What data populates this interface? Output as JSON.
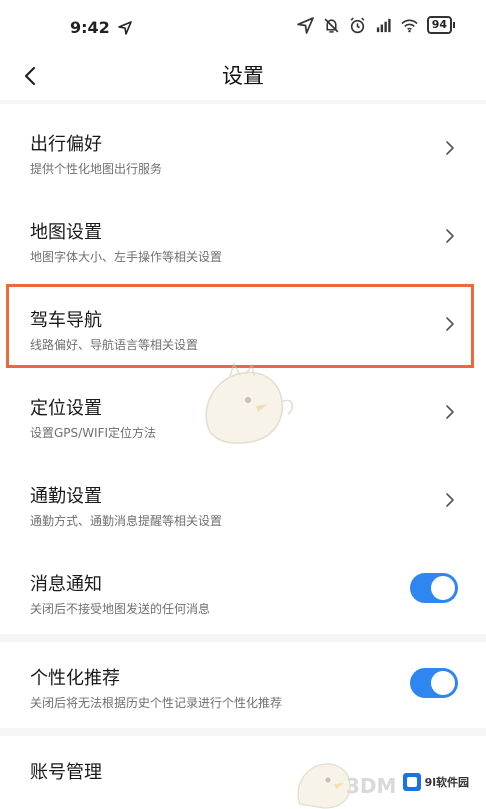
{
  "status_bar": {
    "time": "9:42",
    "battery": "94",
    "icons": [
      "location-arrow-icon",
      "alarm-off-icon",
      "alarm-icon",
      "hd-signal-icon",
      "wifi-icon",
      "battery-icon"
    ]
  },
  "header": {
    "title": "设置",
    "back_icon": "chevron-left-icon"
  },
  "rows": [
    {
      "title": "出行偏好",
      "subtitle": "提供个性化地图出行服务",
      "control": "chevron"
    },
    {
      "title": "地图设置",
      "subtitle": "地图字体大小、左手操作等相关设置",
      "control": "chevron"
    },
    {
      "title": "驾车导航",
      "subtitle": "线路偏好、导航语言等相关设置",
      "control": "chevron",
      "highlighted": true
    },
    {
      "title": "定位设置",
      "subtitle": "设置GPS/WIFI定位方法",
      "control": "chevron"
    },
    {
      "title": "通勤设置",
      "subtitle": "通勤方式、通勤消息提醒等相关设置",
      "control": "chevron"
    },
    {
      "title": "消息通知",
      "subtitle": "关闭后不接受地图发送的任何消息",
      "control": "toggle",
      "enabled": true
    },
    {
      "title": "个性化推荐",
      "subtitle": "关闭后将无法根据历史个性记录进行个性化推荐",
      "control": "toggle",
      "enabled": true
    },
    {
      "title": "账号管理",
      "subtitle": "",
      "control": "chevron"
    }
  ],
  "watermarks": {
    "brand": "9l软件园",
    "text_3d": "3DM"
  },
  "colors": {
    "accent_toggle": "#2e86f0",
    "highlight_border": "#ea6a3c",
    "background": "#f6f6f6"
  }
}
